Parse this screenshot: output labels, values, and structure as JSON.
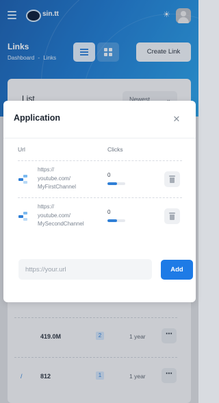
{
  "app": {
    "logo_text": "sin.tt"
  },
  "header": {
    "title": "Links",
    "breadcrumb": [
      "Dashboard",
      "-",
      "Links"
    ],
    "create_label": "Create Link"
  },
  "list": {
    "title": "List",
    "sort": "Newest",
    "rows": [
      {
        "short": "",
        "clicks": "419.0M",
        "badge": "2",
        "age": "1 year",
        "more": "⋯"
      },
      {
        "short": "/",
        "clicks": "812",
        "badge": "1",
        "age": "1 year",
        "more": "⋯"
      }
    ]
  },
  "modal": {
    "title": "Application",
    "columns": {
      "url": "Url",
      "clicks": "Clicks"
    },
    "links": [
      {
        "url_lines": [
          "https://",
          "youtube.com/",
          "MyFirstChannel"
        ],
        "clicks": "0",
        "progress": 0.55
      },
      {
        "url_lines": [
          "https://",
          "youtube.com/",
          "MySecondChannel"
        ],
        "clicks": "0",
        "progress": 0.55
      }
    ],
    "input_placeholder": "https://your.url",
    "add_label": "Add"
  },
  "colors": {
    "accent": "#1e7be6",
    "header_bg": "#1e7ad0"
  },
  "icons": [
    "menu-icon",
    "sun-icon",
    "list-view-icon",
    "grid-view-icon",
    "close-icon",
    "link-icon",
    "trash-icon",
    "chevron-down-icon"
  ]
}
